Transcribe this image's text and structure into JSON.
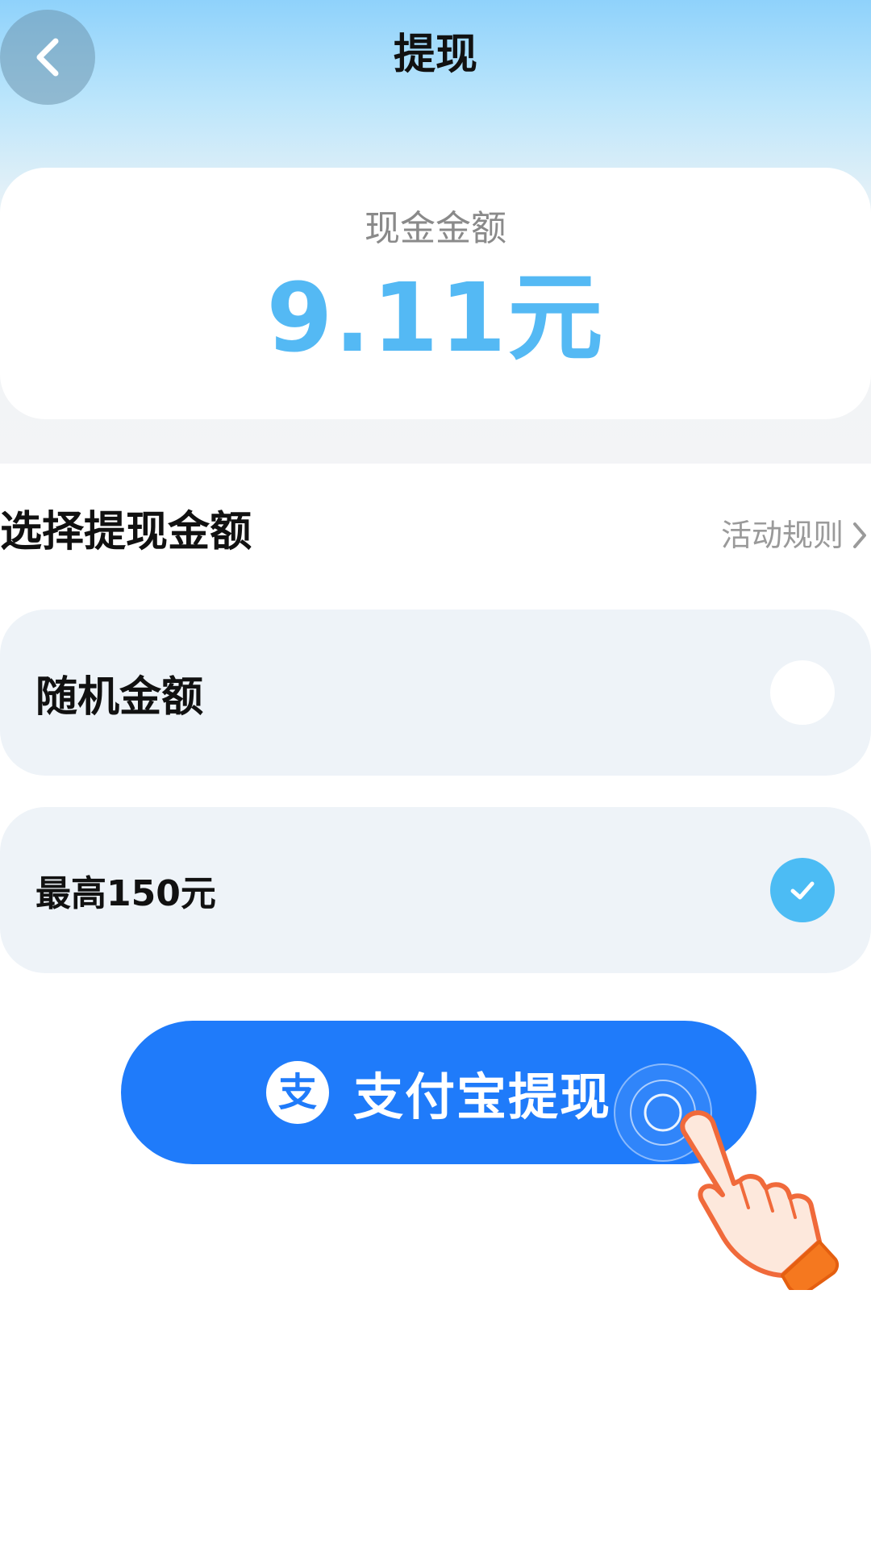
{
  "header": {
    "title": "提现",
    "back_icon": "chevron-left-icon"
  },
  "balance": {
    "label": "现金金额",
    "value": "9.11元",
    "color": "#54b9f4"
  },
  "withdraw_section": {
    "title": "选择提现金额",
    "rules_label": "活动规则",
    "rules_icon": "chevron-right-icon"
  },
  "options": [
    {
      "label": "随机金额",
      "selected": false
    },
    {
      "label": "最高150元",
      "selected": true
    }
  ],
  "withdraw_button": {
    "label": "支付宝提现",
    "icon_glyph": "支",
    "color": "#1f7bfa"
  }
}
